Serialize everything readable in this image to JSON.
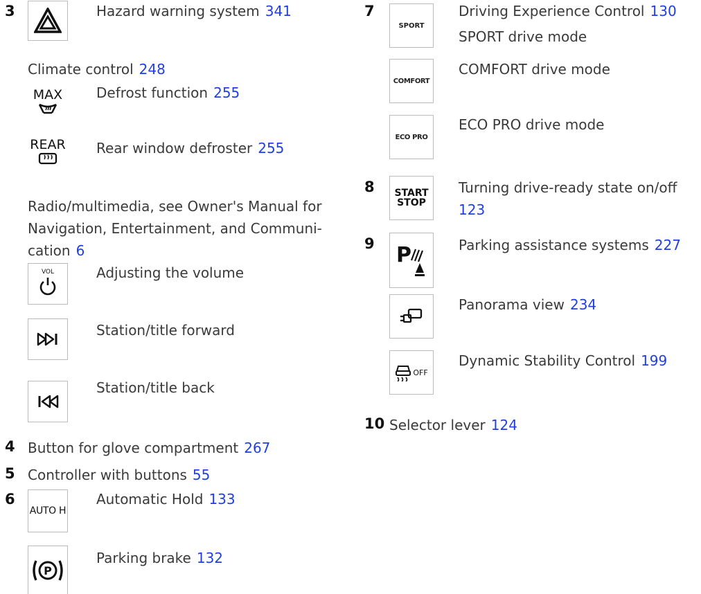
{
  "left": {
    "item3": {
      "number": "3",
      "hazard": {
        "text": "Hazard warning system",
        "page": "341"
      },
      "climate": {
        "text": "Climate control",
        "page": "248"
      },
      "defrost": {
        "text": "Defrost function",
        "page": "255",
        "icon_top": "MAX"
      },
      "rear_defrost": {
        "text": "Rear window defroster",
        "page": "255",
        "icon_top": "REAR"
      },
      "radio": {
        "line1": "Radio/multimedia, see Owner's Manual for",
        "line2": "Navigation, Entertainment, and Communi-",
        "line3": "cation",
        "page": "6"
      },
      "volume": {
        "text": "Adjusting the volume",
        "icon_label": "VOL"
      },
      "forward": {
        "text": "Station/title forward"
      },
      "back": {
        "text": "Station/title back"
      }
    },
    "item4": {
      "number": "4",
      "text": "Button for glove compartment",
      "page": "267"
    },
    "item5": {
      "number": "5",
      "text": "Controller with buttons",
      "page": "55"
    },
    "item6": {
      "number": "6",
      "auto_hold": {
        "text": "Automatic Hold",
        "page": "133",
        "icon_label": "AUTO H"
      },
      "parking_brake": {
        "text": "Parking brake",
        "page": "132"
      }
    }
  },
  "right": {
    "item7": {
      "number": "7",
      "dec": {
        "text": "Driving Experience Control",
        "page": "130"
      },
      "sport": {
        "text": "SPORT drive mode",
        "icon_label": "SPORT"
      },
      "comfort": {
        "text": "COMFORT drive mode",
        "icon_label": "COMFORT"
      },
      "eco": {
        "text": "ECO PRO drive mode",
        "icon_label": "ECO PRO"
      }
    },
    "item8": {
      "number": "8",
      "line1": "Turning drive-ready state on/off",
      "page": "123",
      "icon_line1": "START",
      "icon_line2": "STOP"
    },
    "item9": {
      "number": "9",
      "park_assist": {
        "text": "Parking assistance systems",
        "page": "227"
      },
      "panorama": {
        "text": "Panorama view",
        "page": "234"
      },
      "dsc": {
        "text": "Dynamic Stability Control",
        "page": "199",
        "icon_label": "OFF"
      }
    },
    "item10": {
      "number": "10",
      "text": "Selector lever",
      "page": "124"
    }
  }
}
